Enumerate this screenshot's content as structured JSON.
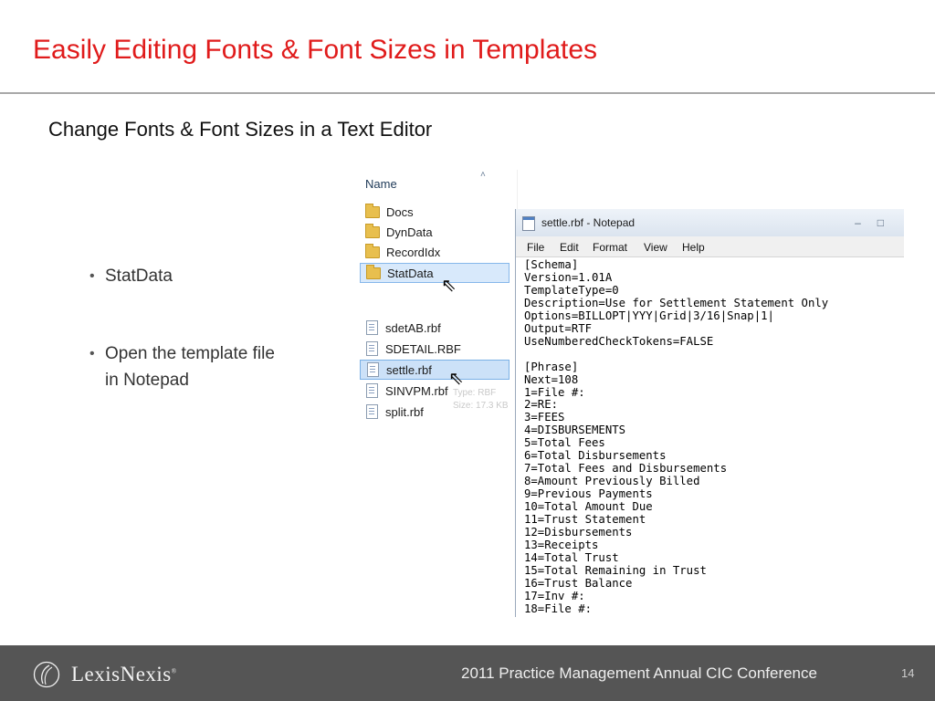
{
  "slide": {
    "title": "Easily Editing Fonts & Font Sizes in Templates",
    "subtitle": "Change Fonts & Font Sizes in a Text Editor",
    "bullets": [
      "StatData",
      "Open the template file in Notepad"
    ],
    "bullet_2_lines": [
      "Open the template file",
      "in Notepad"
    ],
    "colors": {
      "title": "#e01b1b",
      "footer_bg": "#555555",
      "rule": "#a8a8a8"
    }
  },
  "explorer": {
    "column_header": "Name",
    "folders": [
      "Docs",
      "DynData",
      "RecordIdx",
      "StatData"
    ],
    "files": [
      "sdetAB.rbf",
      "SDETAIL.RBF",
      "settle.rbf",
      "SINVPM.rbf",
      "split.rbf"
    ],
    "tooltip_lines": [
      "Type: RBF",
      "Size: 17.3 KB"
    ],
    "icons": [
      "folder-icon",
      "file-icon",
      "mouse-cursor-icon"
    ]
  },
  "notepad": {
    "title": "settle.rbf - Notepad",
    "menu": [
      "File",
      "Edit",
      "Format",
      "View",
      "Help"
    ],
    "content": "[Schema]\nVersion=1.01A\nTemplateType=0\nDescription=Use for Settlement Statement Only\nOptions=BILLOPT|YYY|Grid|3/16|Snap|1|\nOutput=RTF\nUseNumberedCheckTokens=FALSE\n\n[Phrase]\nNext=108\n1=File #:\n2=RE:\n3=FEES\n4=DISBURSEMENTS\n5=Total Fees\n6=Total Disbursements\n7=Total Fees and Disbursements\n8=Amount Previously Billed\n9=Previous Payments\n10=Total Amount Due\n11=Trust Statement\n12=Disbursements\n13=Receipts\n14=Total Trust\n15=Total Remaining in Trust\n16=Trust Balance\n17=Inv #:\n18=File #:"
  },
  "footer": {
    "logo": "LexisNexis",
    "conference": "2011 Practice Management Annual CIC Conference",
    "page_number": "14"
  }
}
